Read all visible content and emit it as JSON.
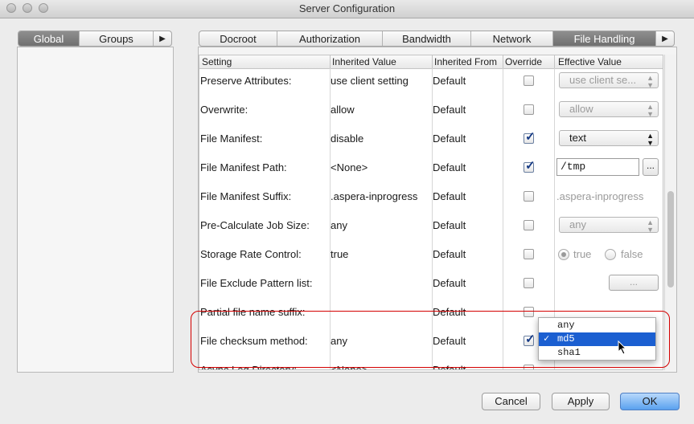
{
  "window": {
    "title": "Server Configuration"
  },
  "left_tabs": [
    {
      "label": "Global",
      "active": true
    },
    {
      "label": "Groups",
      "active": false
    }
  ],
  "right_tabs": [
    {
      "label": "Docroot",
      "active": false
    },
    {
      "label": "Authorization",
      "active": false
    },
    {
      "label": "Bandwidth",
      "active": false
    },
    {
      "label": "Network",
      "active": false
    },
    {
      "label": "File Handling",
      "active": true
    }
  ],
  "table": {
    "columns": [
      "Setting",
      "Inherited Value",
      "Inherited From",
      "Override",
      "Effective Value"
    ],
    "rows": [
      {
        "setting": "Preserve Attributes:",
        "inherited_value": "use client setting",
        "inherited_from": "Default",
        "override": false,
        "effective": "use client se..."
      },
      {
        "setting": "Overwrite:",
        "inherited_value": "allow",
        "inherited_from": "Default",
        "override": false,
        "effective": "allow"
      },
      {
        "setting": "File Manifest:",
        "inherited_value": "disable",
        "inherited_from": "Default",
        "override": true,
        "effective": "text"
      },
      {
        "setting": "File Manifest Path:",
        "inherited_value": "<None>",
        "inherited_from": "Default",
        "override": true,
        "effective": "/tmp",
        "browse": "..."
      },
      {
        "setting": "File Manifest Suffix:",
        "inherited_value": ".aspera-inprogress",
        "inherited_from": "Default",
        "override": false,
        "effective": ".aspera-inprogress"
      },
      {
        "setting": "Pre-Calculate Job Size:",
        "inherited_value": "any",
        "inherited_from": "Default",
        "override": false,
        "effective": "any"
      },
      {
        "setting": "Storage Rate Control:",
        "inherited_value": "true",
        "inherited_from": "Default",
        "override": false,
        "radio_true": "true",
        "radio_false": "false"
      },
      {
        "setting": "File Exclude Pattern list:",
        "inherited_value": "",
        "inherited_from": "Default",
        "override": false,
        "button": "..."
      },
      {
        "setting": "Partial file name suffix:",
        "inherited_value": "",
        "inherited_from": "Default",
        "override": false
      },
      {
        "setting": "File checksum method:",
        "inherited_value": "any",
        "inherited_from": "Default",
        "override": true
      },
      {
        "setting": "Async Log Directory:",
        "inherited_value": "<None>",
        "inherited_from": "Default",
        "override": false
      }
    ]
  },
  "checksum_dropdown": {
    "options": [
      "any",
      "md5",
      "sha1"
    ],
    "selected": "md5",
    "check_mark": "✓"
  },
  "buttons": {
    "cancel": "Cancel",
    "apply": "Apply",
    "ok": "OK"
  },
  "colors": {
    "selection": "#1b5fd1",
    "highlight": "#d40000",
    "primary_button": "#5aa1ef"
  }
}
